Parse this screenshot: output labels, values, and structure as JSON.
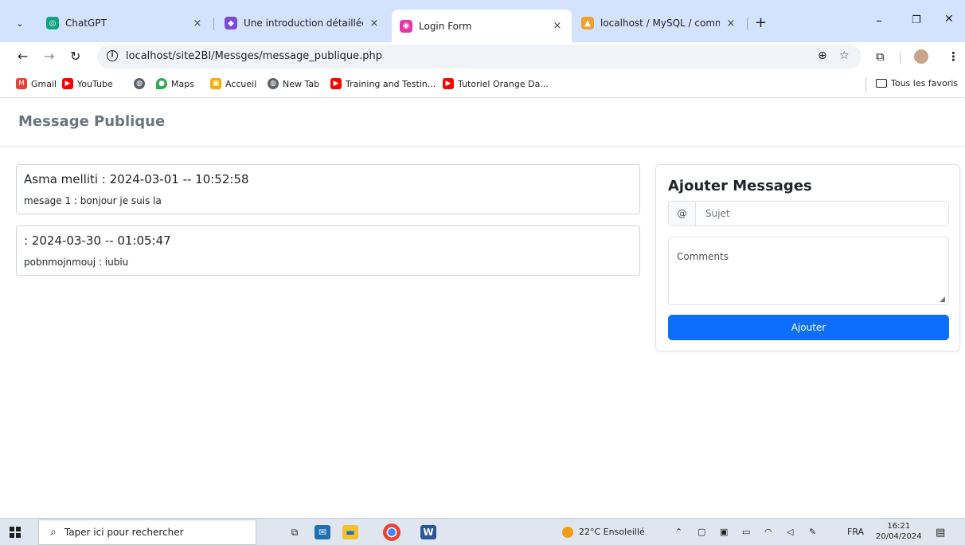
{
  "browser": {
    "tabs": [
      {
        "label": "ChatGPT",
        "icon": "chatgpt-icon",
        "color": "#10a37f"
      },
      {
        "label": "Une introduction détaillée | Ga",
        "icon": "site-icon",
        "color": "#7b4bd6"
      },
      {
        "label": "Login Form",
        "icon": "site-icon",
        "color": "#e535ab"
      },
      {
        "label": "localhost / MySQL / commun",
        "icon": "phpmyadmin-icon",
        "color": "#f0a030"
      }
    ],
    "active_tab_index": 2,
    "tab_close_glyph": "×",
    "new_tab_glyph": "+",
    "window_controls": {
      "minimize": "–",
      "maximize": "❐",
      "close": "✕"
    },
    "url": "localhost/site2BI/Messges/message_publique.php",
    "bookmarks": [
      {
        "label": "Gmail",
        "icon": "gmail-icon",
        "color": "#ea4335"
      },
      {
        "label": "YouTube",
        "icon": "youtube-icon",
        "color": "#ff0000"
      },
      {
        "label": "",
        "icon": "globe-icon",
        "color": "#5f6368"
      },
      {
        "label": "Maps",
        "icon": "maps-icon",
        "color": "#34a853"
      },
      {
        "label": "Accueil",
        "icon": "accueil-icon",
        "color": "#f9ab00"
      },
      {
        "label": "New Tab",
        "icon": "globe-icon",
        "color": "#5f6368"
      },
      {
        "label": "Training and Testin...",
        "icon": "youtube-icon",
        "color": "#ff0000"
      },
      {
        "label": "Tutoriel Orange Da...",
        "icon": "youtube-icon",
        "color": "#ff0000"
      }
    ],
    "all_bookmarks_label": "Tous les favoris"
  },
  "page": {
    "brand": "Message Publique",
    "messages": [
      {
        "title": "Asma melliti : 2024-03-01 -- 10:52:58",
        "body": "mesage 1 : bonjour je suis la"
      },
      {
        "title": ": 2024-03-30 -- 01:05:47",
        "body": "pobnmojnmouj : iubiu"
      }
    ],
    "form": {
      "title": "Ajouter Messages",
      "prefix": "@",
      "subject_placeholder": "Sujet",
      "comments_placeholder": "Comments",
      "submit_label": "Ajouter"
    },
    "accent_color": "#0d6efd"
  },
  "taskbar": {
    "search_placeholder": "Taper ici pour rechercher",
    "weather": "22°C  Ensoleillé",
    "language": "FRA",
    "time": "16:21",
    "date": "20/04/2024"
  }
}
